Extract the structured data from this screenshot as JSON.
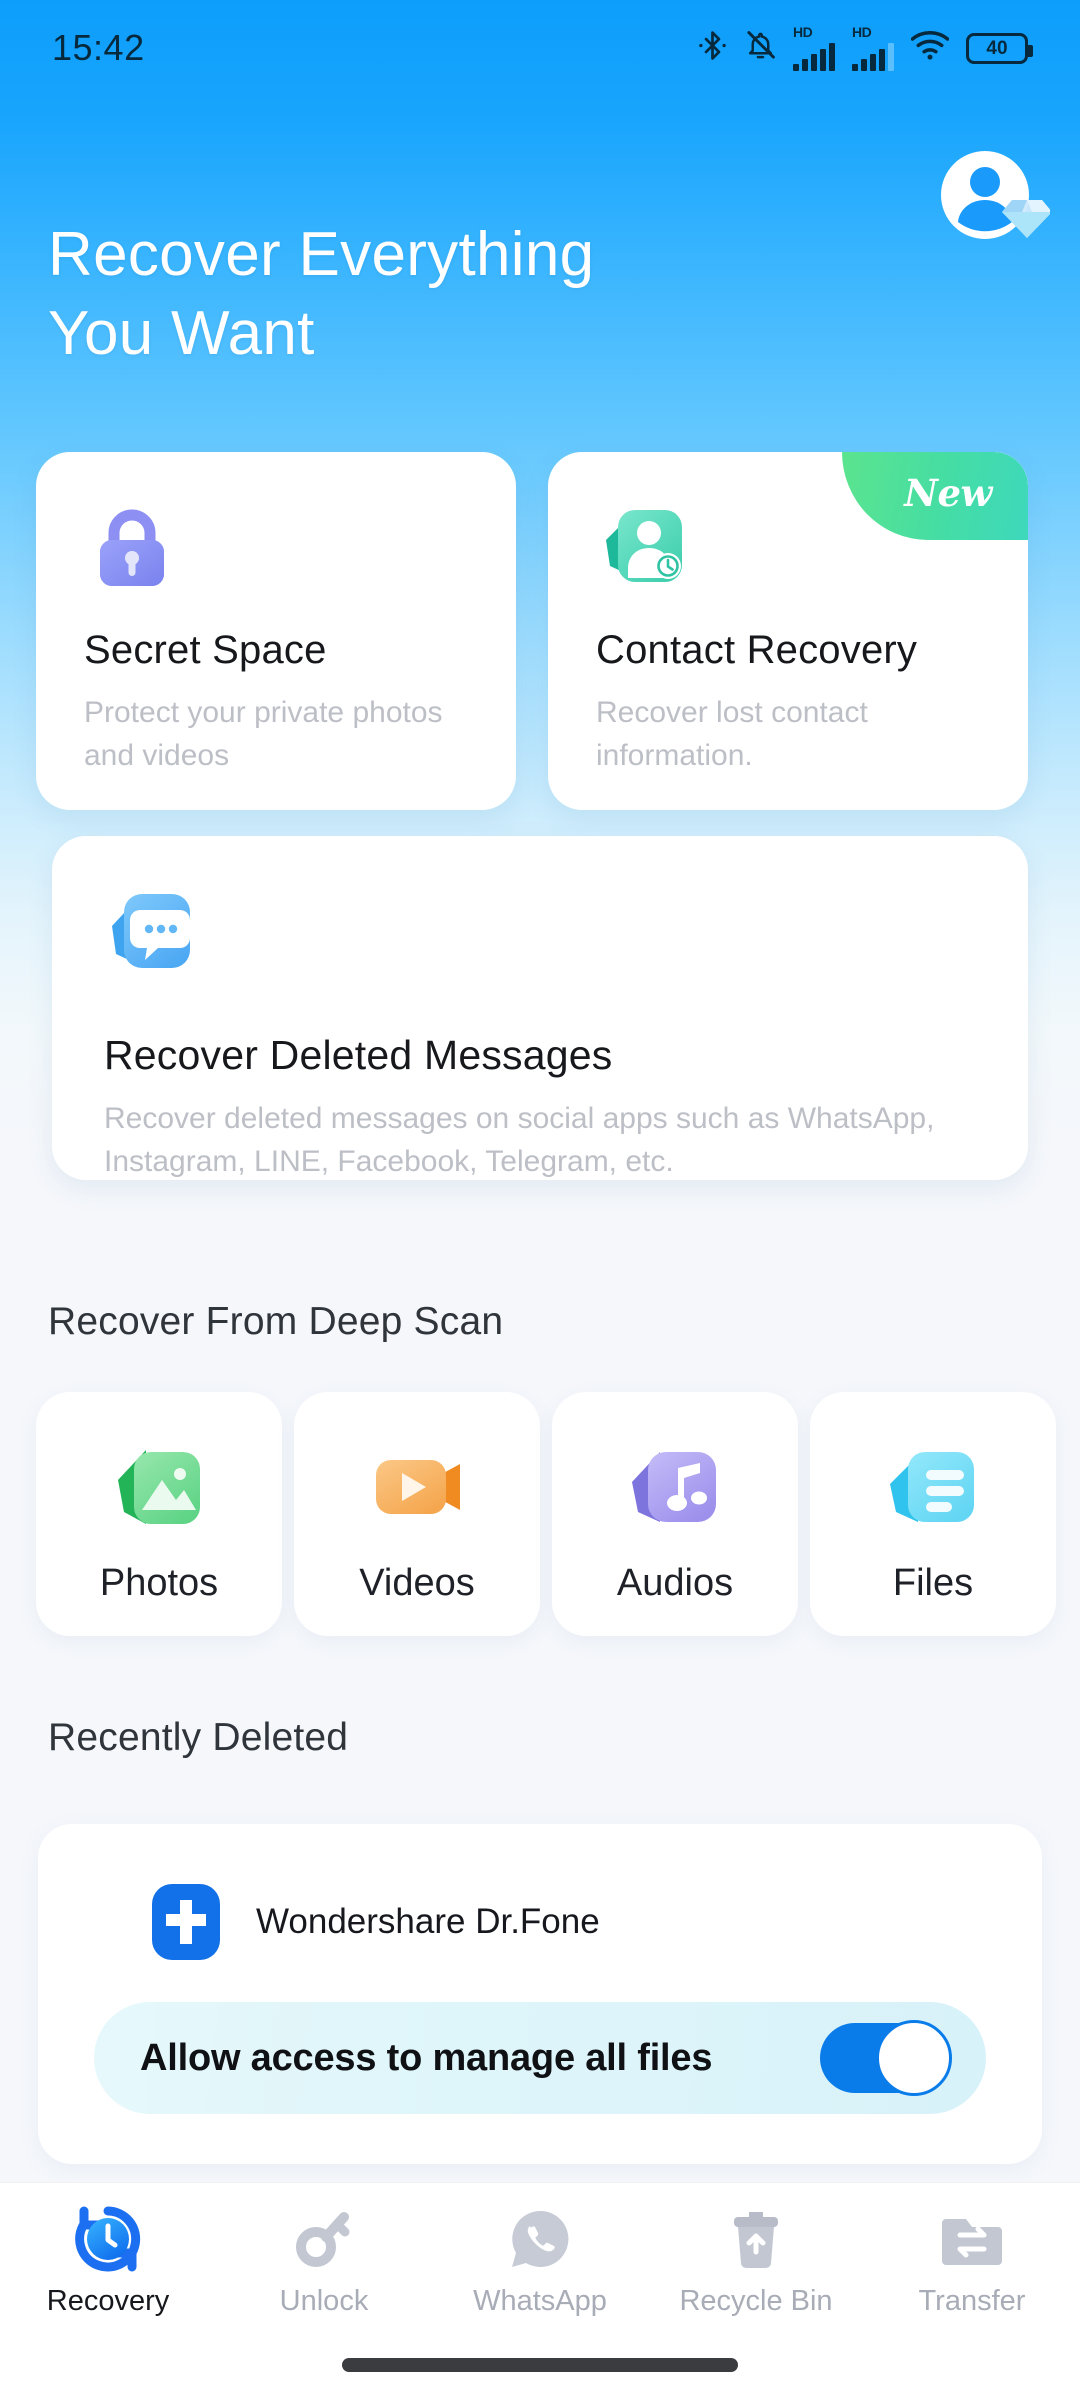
{
  "status_bar": {
    "time": "15:42",
    "battery_level": "40",
    "icons": [
      "bluetooth-icon",
      "notification-muted-icon",
      "signal-hd-1-icon",
      "signal-hd-2-icon",
      "wifi-icon",
      "battery-icon"
    ],
    "hd_label": "HD"
  },
  "header": {
    "title_line1": "Recover Everything",
    "title_line2": "You Want",
    "avatar": "user-avatar-premium"
  },
  "feature_cards": [
    {
      "id": "secret-space",
      "icon": "lock-icon",
      "title": "Secret Space",
      "description": "Protect your private photos and videos",
      "badge": null
    },
    {
      "id": "contact-recovery",
      "icon": "contact-clock-icon",
      "title": "Contact Recovery",
      "description": "Recover lost contact information.",
      "badge": "New"
    },
    {
      "id": "recover-deleted-messages",
      "icon": "chat-bubble-icon",
      "title": "Recover Deleted Messages",
      "description": "Recover deleted messages on social apps such as WhatsApp, Instagram, LINE, Facebook, Telegram, etc.",
      "badge": null
    }
  ],
  "deep_scan": {
    "section_title": "Recover From Deep Scan",
    "tiles": [
      {
        "label": "Photos",
        "icon": "photo-icon",
        "color": "#6DD88A"
      },
      {
        "label": "Videos",
        "icon": "video-icon",
        "color": "#F8B25F"
      },
      {
        "label": "Audios",
        "icon": "audio-icon",
        "color": "#A99EF0"
      },
      {
        "label": "Files",
        "icon": "file-icon",
        "color": "#6FDCF5"
      }
    ]
  },
  "recently_deleted": {
    "section_title": "Recently Deleted",
    "app_name": "Wondershare Dr.Fone",
    "app_icon": "drfone-icon",
    "permission_label": "Allow access to manage all files",
    "permission_enabled": true
  },
  "bottom_nav": {
    "items": [
      {
        "label": "Recovery",
        "icon": "recovery-clock-icon",
        "active": true
      },
      {
        "label": "Unlock",
        "icon": "key-icon",
        "active": false
      },
      {
        "label": "WhatsApp",
        "icon": "whatsapp-icon",
        "active": false
      },
      {
        "label": "Recycle Bin",
        "icon": "trash-icon",
        "active": false
      },
      {
        "label": "Transfer",
        "icon": "transfer-folder-icon",
        "active": false
      }
    ]
  },
  "colors": {
    "hero_top": "#0D9EFC",
    "accent_blue": "#0A7CEA",
    "badge_green": "#45DDA4",
    "page_bg": "#F5F7FB"
  }
}
